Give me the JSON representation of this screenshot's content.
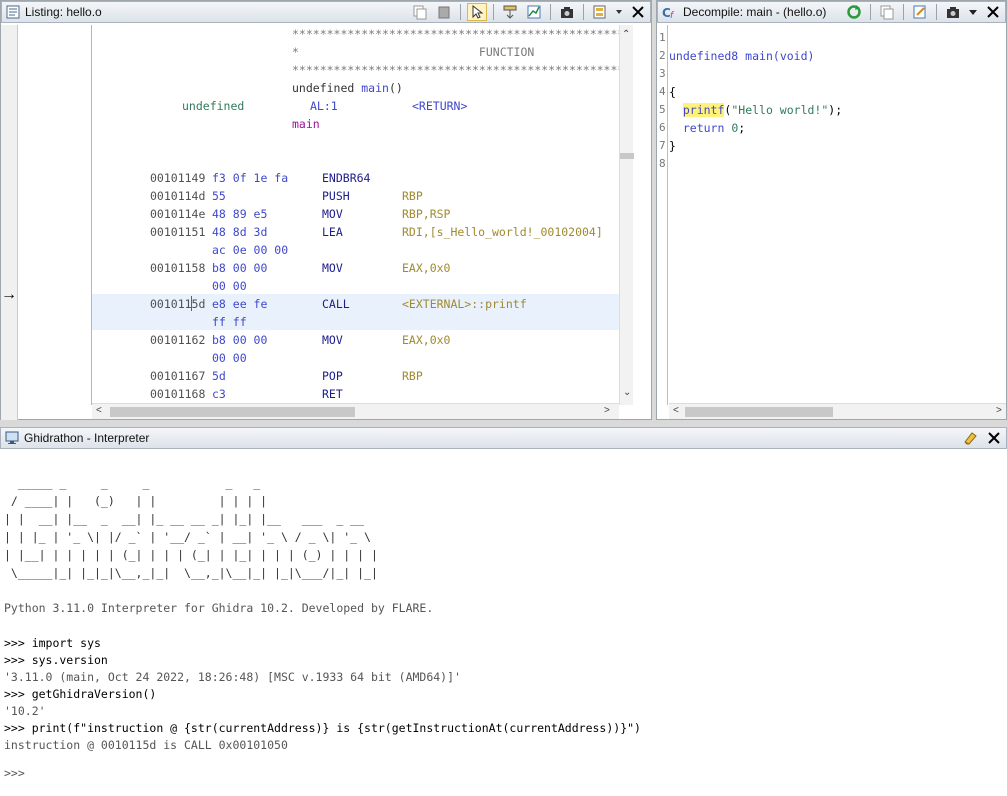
{
  "listing": {
    "title": "Listing:  hello.o",
    "header": {
      "stars": "**************************************************************",
      "function_label": "*                          FUNCTION",
      "signature_type": "undefined ",
      "signature_name": "main",
      "signature_args": "()",
      "ret_type": "undefined",
      "ret_reg": "AL:1",
      "ret_label": "<RETURN>",
      "label": "main"
    },
    "rows": [
      {
        "addr": "00101149",
        "bytes": "f3 0f 1e fa",
        "mnem": "ENDBR64",
        "ops": ""
      },
      {
        "addr": "0010114d",
        "bytes": "55",
        "mnem": "PUSH",
        "ops": "RBP"
      },
      {
        "addr": "0010114e",
        "bytes": "48 89 e5",
        "mnem": "MOV",
        "ops": "RBP,RSP"
      },
      {
        "addr": "00101151",
        "bytes": "48 8d 3d",
        "mnem": "LEA",
        "ops": "RDI,[s_Hello_world!_00102004]"
      },
      {
        "addr": "",
        "bytes": "ac 0e 00 00",
        "mnem": "",
        "ops": ""
      },
      {
        "addr": "00101158",
        "bytes": "b8 00 00",
        "mnem": "MOV",
        "ops": "EAX,0x0"
      },
      {
        "addr": "",
        "bytes": "00 00",
        "mnem": "",
        "ops": ""
      },
      {
        "addr": "0010115d",
        "bytes": "e8 ee fe",
        "mnem": "CALL",
        "ops": "<EXTERNAL>::printf"
      },
      {
        "addr": "",
        "bytes": "ff ff",
        "mnem": "",
        "ops": ""
      },
      {
        "addr": "00101162",
        "bytes": "b8 00 00",
        "mnem": "MOV",
        "ops": "EAX,0x0"
      },
      {
        "addr": "",
        "bytes": "00 00",
        "mnem": "",
        "ops": ""
      },
      {
        "addr": "00101167",
        "bytes": "5d",
        "mnem": "POP",
        "ops": "RBP"
      },
      {
        "addr": "00101168",
        "bytes": "c3",
        "mnem": "RET",
        "ops": ""
      }
    ],
    "cursor_marker": "→"
  },
  "decompile": {
    "title": "Decompile: main -  (hello.o)",
    "line_numbers": [
      "1",
      "2",
      "3",
      "4",
      "5",
      "6",
      "7",
      "8"
    ],
    "lines": [
      {
        "parts": []
      },
      {
        "parts": [
          {
            "t": "undefined8 ",
            "c": "kw"
          },
          {
            "t": "main",
            "c": "fn"
          },
          {
            "t": "(",
            "c": "kw"
          },
          {
            "t": "void",
            "c": "kw"
          },
          {
            "t": ")",
            "c": "kw"
          }
        ]
      },
      {
        "parts": []
      },
      {
        "parts": [
          {
            "t": "{",
            "c": ""
          }
        ]
      },
      {
        "parts": [
          {
            "t": "  ",
            "c": ""
          },
          {
            "t": "printf",
            "c": "fn yel"
          },
          {
            "t": "(",
            "c": ""
          },
          {
            "t": "\"Hello world!\"",
            "c": "str"
          },
          {
            "t": ");",
            "c": ""
          }
        ]
      },
      {
        "parts": [
          {
            "t": "  ",
            "c": ""
          },
          {
            "t": "return",
            "c": "kw"
          },
          {
            "t": " ",
            "c": ""
          },
          {
            "t": "0",
            "c": "num"
          },
          {
            "t": ";",
            "c": ""
          }
        ]
      },
      {
        "parts": [
          {
            "t": "}",
            "c": ""
          }
        ]
      },
      {
        "parts": []
      }
    ]
  },
  "interpreter": {
    "title": "Ghidrathon - Interpreter",
    "banner": [
      "  _____ _     _     _           _   _",
      " / ____| |   (_)   | |         | | | |",
      "| |  __| |__  _  __| |_ __ __ _| |_| |__   ___  _ __",
      "| | |_ | '_ \\| |/ _` | '__/ _` | __| '_ \\ / _ \\| '_ \\",
      "| |__| | | | | | (_| | | | (_| | |_| | | | (_) | | | |",
      " \\_____|_| |_|_|\\__,_|_|  \\__,_|\\__|_| |_|\\___/|_| |_|"
    ],
    "intro": "Python 3.11.0 Interpreter for Ghidra 10.2. Developed by FLARE.",
    "session": [
      {
        "type": "cmd",
        "text": ">>> import sys"
      },
      {
        "type": "cmd",
        "text": ">>> sys.version"
      },
      {
        "type": "out",
        "text": "'3.11.0 (main, Oct 24 2022, 18:26:48) [MSC v.1933 64 bit (AMD64)]'"
      },
      {
        "type": "cmd",
        "text": ">>> getGhidraVersion()"
      },
      {
        "type": "out",
        "text": "'10.2'"
      },
      {
        "type": "cmd",
        "text": ">>> print(f\"instruction @ {str(currentAddress)} is {str(getInstructionAt(currentAddress))}\")"
      },
      {
        "type": "out",
        "text": "instruction @ 0010115d is CALL 0x00101050"
      }
    ],
    "prompt": ">>>"
  }
}
